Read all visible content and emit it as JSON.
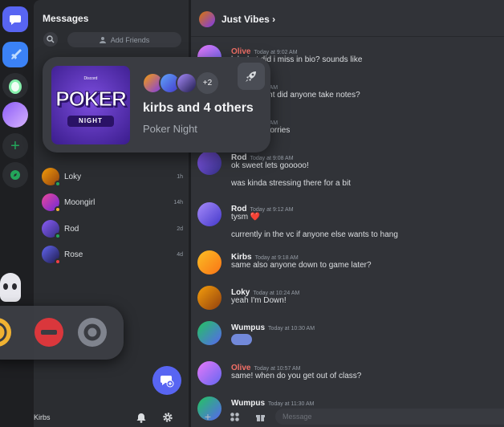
{
  "rail": {
    "colors": {
      "accent": "#5865f2",
      "green": "#23a55a"
    }
  },
  "dm_panel": {
    "title": "Messages",
    "add_friends_label": "Add Friends",
    "items": [
      {
        "name": "Loky",
        "time": "1h",
        "status": "online"
      },
      {
        "name": "Moongirl",
        "time": "14h",
        "status": "idle"
      },
      {
        "name": "Rod",
        "time": "2d",
        "status": "online"
      },
      {
        "name": "Rose",
        "time": "4d",
        "status": "dnd"
      }
    ],
    "user": {
      "name": "Kirbs"
    }
  },
  "chat": {
    "title": "Just Vibes",
    "title_suffix": "›",
    "input_placeholder": "Message",
    "messages": [
      {
        "author": "Olive",
        "time": "Today at 9:02 AM",
        "lines": [
          "lol what did i miss in bio? sounds like"
        ],
        "color": "#f47067"
      },
      {
        "author": "",
        "time": "Today at 9:04 AM",
        "lines": [
          "sounds right did anyone take notes?"
        ],
        "color": "#f2f3f5"
      },
      {
        "author": "",
        "time": "Today at 9:04 AM",
        "lines": [
          "notes no worries"
        ],
        "color": "#f2f3f5"
      },
      {
        "author": "Rod",
        "time": "Today at 9:08 AM",
        "lines": [
          "ok sweet lets gooooo!",
          "was kinda stressing there for a bit"
        ],
        "color": "#f2f3f5"
      },
      {
        "author": "Rod",
        "time": "Today at 9:12 AM",
        "lines": [
          "tysm ❤️",
          "currently in the vc if anyone else wants to hang"
        ],
        "color": "#f2f3f5"
      },
      {
        "author": "Kirbs",
        "time": "Today at 9:18 AM",
        "lines": [
          "same also anyone down to game later?"
        ],
        "color": "#f2f3f5"
      },
      {
        "author": "Loky",
        "time": "Today at 10:24 AM",
        "lines": [
          "yeah I'm Down!"
        ],
        "color": "#f2f3f5"
      },
      {
        "author": "Wumpus",
        "time": "Today at 10:30 AM",
        "lines": [
          ""
        ],
        "color": "#f2f3f5"
      },
      {
        "author": "Olive",
        "time": "Today at 10:57 AM",
        "lines": [
          "same! when do you get out of class?"
        ],
        "color": "#f47067"
      },
      {
        "author": "Wumpus",
        "time": "Today at 11:30 AM",
        "lines": [
          ""
        ],
        "color": "#f2f3f5"
      }
    ]
  },
  "invite": {
    "brand": "Discord",
    "game_logo_top": "POKER",
    "game_logo_bottom": "NIGHT",
    "more_count": "+2",
    "title": "kirbs and 4 others",
    "subtitle": "Poker Night"
  },
  "icons": [
    "messages-icon",
    "sword-icon",
    "egg-icon",
    "add-server-icon",
    "compass-icon",
    "search-icon",
    "add-friend-icon",
    "new-message-icon",
    "bell-icon",
    "gear-icon",
    "plus-icon",
    "apps-icon",
    "gift-icon",
    "rocket-icon",
    "emoji-icon"
  ]
}
